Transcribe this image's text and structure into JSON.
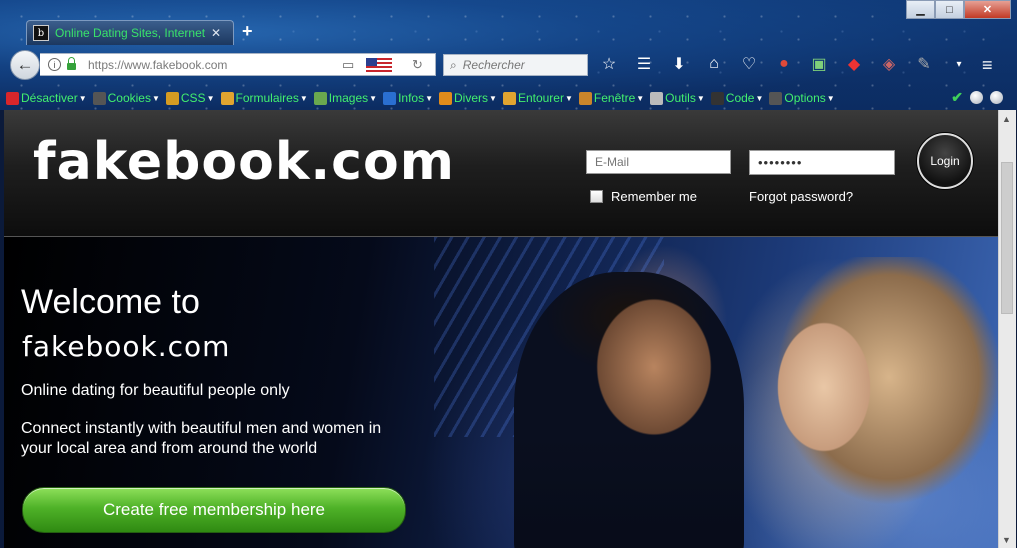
{
  "browser": {
    "tab_title": "Online Dating Sites, Internet",
    "tab_favicon_letter": "b",
    "url_prefix": "https://www.",
    "url_domain": "fakebook.com",
    "search_placeholder": "Rechercher",
    "new_tab_label": "+",
    "window_controls": [
      "minimize",
      "maximize",
      "close"
    ]
  },
  "bookmarks": [
    {
      "label": "Désactiver",
      "icon": "no-entry-icon",
      "color": "#d8262b"
    },
    {
      "label": "Cookies",
      "icon": "cookie-icon",
      "color": "#555555"
    },
    {
      "label": "CSS",
      "icon": "css-wand-icon",
      "color": "#d49b22"
    },
    {
      "label": "Formulaires",
      "icon": "form-icon",
      "color": "#e0a430"
    },
    {
      "label": "Images",
      "icon": "image-icon",
      "color": "#6aa84f"
    },
    {
      "label": "Infos",
      "icon": "info-icon",
      "color": "#2a6fd1"
    },
    {
      "label": "Divers",
      "icon": "misc-icon",
      "color": "#e08b1b"
    },
    {
      "label": "Entourer",
      "icon": "pencil-icon",
      "color": "#e0a430"
    },
    {
      "label": "Fenêtre",
      "icon": "ruler-icon",
      "color": "#c9852b"
    },
    {
      "label": "Outils",
      "icon": "tools-icon",
      "color": "#bbbbbb"
    },
    {
      "label": "Code",
      "icon": "code-icon",
      "color": "#333333"
    },
    {
      "label": "Options",
      "icon": "options-icon",
      "color": "#555555"
    }
  ],
  "site": {
    "logo": "fakebook.com",
    "email_placeholder": "E-Mail",
    "password_mask": "••••••••",
    "remember_label": "Remember me",
    "forgot_label": "Forgot password?",
    "login_label": "Login",
    "welcome_line1": "Welcome to",
    "welcome_line2": "fakebook.com",
    "tagline": "Online dating for beautiful people only",
    "description": "Connect instantly with beautiful men and women in your local area and from around the world",
    "cta_label": "Create free membership here"
  },
  "colors": {
    "tab_title": "#39e36a",
    "bookmark_text": "#42f06e",
    "cta_green": "#4fb228"
  }
}
